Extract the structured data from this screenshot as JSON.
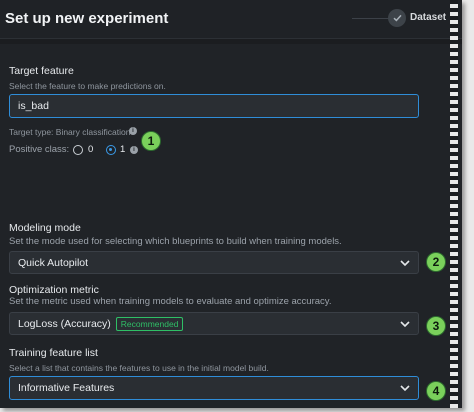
{
  "header": {
    "title": "Set up new experiment",
    "step_label": "Dataset"
  },
  "target": {
    "heading": "Target feature",
    "description": "Select the feature to make predictions on.",
    "value": "is_bad",
    "type_text": "Target type: Binary classification",
    "positive_class_label": "Positive class:",
    "options": [
      "0",
      "1"
    ],
    "selected": "1"
  },
  "modeling_mode": {
    "heading": "Modeling mode",
    "description": "Set the mode used for selecting which blueprints to build when training models.",
    "value": "Quick Autopilot"
  },
  "metric": {
    "heading": "Optimization metric",
    "description": "Set the metric used when training models to evaluate and optimize accuracy.",
    "value": "LogLoss (Accuracy)",
    "badge": "Recommended"
  },
  "feature_list": {
    "heading": "Training feature list",
    "description": "Select a list that contains the features to use in the initial model build.",
    "value": "Informative Features"
  },
  "callouts": [
    "1",
    "2",
    "3",
    "4"
  ],
  "colors": {
    "background": "#202327",
    "callout": "#7ad05b",
    "accent": "#2f8dd8",
    "badge": "#2fbf66"
  }
}
